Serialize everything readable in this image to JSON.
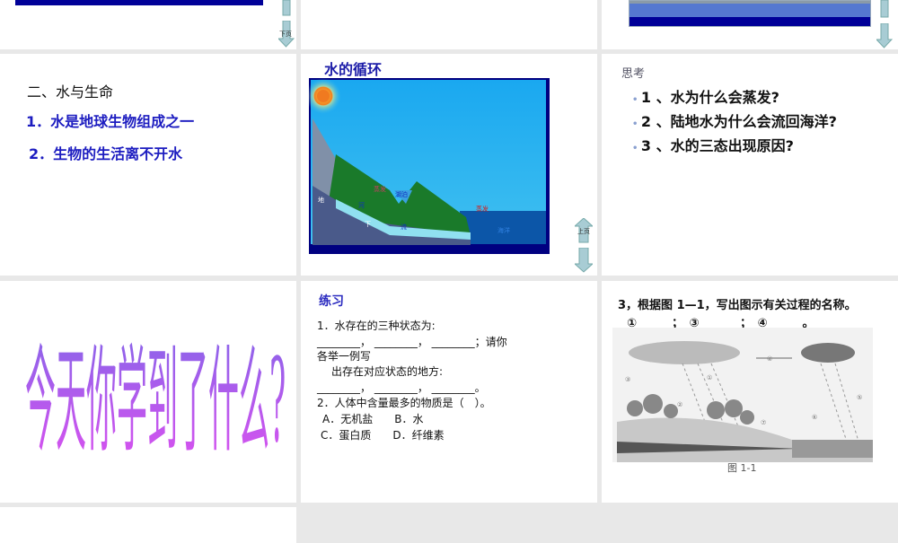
{
  "slides": [
    {
      "id": 1,
      "nav": {
        "next_label": "下页"
      }
    },
    {
      "id": 2
    },
    {
      "id": 3
    },
    {
      "id": 4,
      "heading": "二、水与生命",
      "items": [
        "1．水是地球生物组成之一",
        "2．生物的生活离不开水"
      ]
    },
    {
      "id": 5,
      "title": "水的循环",
      "labels": {
        "evap1": "蒸发",
        "evap2": "蒸发",
        "lake": "湖泊",
        "river": "河",
        "ground": "地",
        "under": "下",
        "flow": "流",
        "ocean": "海洋"
      },
      "nav": {
        "prev_label": "上页"
      }
    },
    {
      "id": 6,
      "heading": "思考",
      "bullets": [
        "1 、水为什么会蒸发?",
        "2 、陆地水为什么会流回海洋?",
        "3 、水的三态出现原因?"
      ]
    },
    {
      "id": 7,
      "big_text": "今天你学到了什么?"
    },
    {
      "id": 8,
      "title": "练习",
      "lines": [
        "1．水存在的三种状态为:",
        "________， ________， ________；请你",
        "各举一例写",
        "　出存在对应状态的地方:",
        "________， ________， ________。",
        "2．人体中含量最多的物质是（　）。",
        "A．无机盐　　B．水",
        "C．蛋白质　　D．纤维素"
      ]
    },
    {
      "id": 9,
      "question": "3，根据图 1—1，写出图示有关过程的名称。",
      "blanks": "①______；　③_______；　④______。",
      "figure_caption": "图 1-1",
      "figure_marks": [
        "①",
        "②",
        "③",
        "④",
        "⑤",
        "⑥",
        "⑦"
      ]
    }
  ],
  "colors": {
    "accent": "#1c1cc0",
    "background": "#e8e8e8",
    "nav_arrow": "#a8ccd4"
  }
}
